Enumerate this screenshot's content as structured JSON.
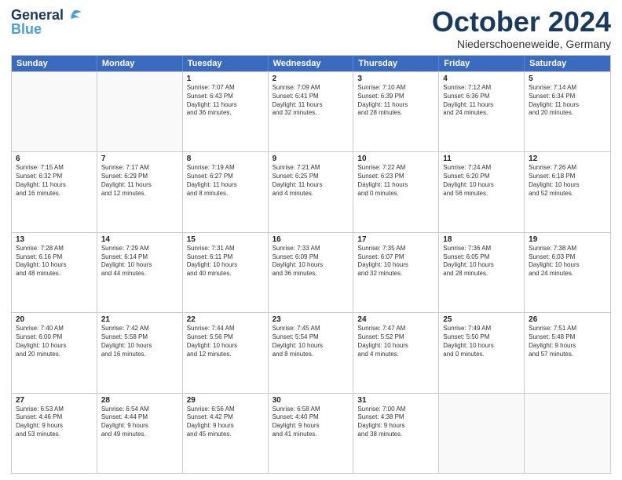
{
  "logo": {
    "line1": "General",
    "line2": "Blue"
  },
  "header": {
    "month": "October 2024",
    "location": "Niederschoeneweide, Germany"
  },
  "weekdays": [
    "Sunday",
    "Monday",
    "Tuesday",
    "Wednesday",
    "Thursday",
    "Friday",
    "Saturday"
  ],
  "weeks": [
    [
      {
        "day": "",
        "text": ""
      },
      {
        "day": "",
        "text": ""
      },
      {
        "day": "1",
        "text": "Sunrise: 7:07 AM\nSunset: 6:43 PM\nDaylight: 11 hours\nand 36 minutes."
      },
      {
        "day": "2",
        "text": "Sunrise: 7:09 AM\nSunset: 6:41 PM\nDaylight: 11 hours\nand 32 minutes."
      },
      {
        "day": "3",
        "text": "Sunrise: 7:10 AM\nSunset: 6:39 PM\nDaylight: 11 hours\nand 28 minutes."
      },
      {
        "day": "4",
        "text": "Sunrise: 7:12 AM\nSunset: 6:36 PM\nDaylight: 11 hours\nand 24 minutes."
      },
      {
        "day": "5",
        "text": "Sunrise: 7:14 AM\nSunset: 6:34 PM\nDaylight: 11 hours\nand 20 minutes."
      }
    ],
    [
      {
        "day": "6",
        "text": "Sunrise: 7:15 AM\nSunset: 6:32 PM\nDaylight: 11 hours\nand 16 minutes."
      },
      {
        "day": "7",
        "text": "Sunrise: 7:17 AM\nSunset: 6:29 PM\nDaylight: 11 hours\nand 12 minutes."
      },
      {
        "day": "8",
        "text": "Sunrise: 7:19 AM\nSunset: 6:27 PM\nDaylight: 11 hours\nand 8 minutes."
      },
      {
        "day": "9",
        "text": "Sunrise: 7:21 AM\nSunset: 6:25 PM\nDaylight: 11 hours\nand 4 minutes."
      },
      {
        "day": "10",
        "text": "Sunrise: 7:22 AM\nSunset: 6:23 PM\nDaylight: 11 hours\nand 0 minutes."
      },
      {
        "day": "11",
        "text": "Sunrise: 7:24 AM\nSunset: 6:20 PM\nDaylight: 10 hours\nand 56 minutes."
      },
      {
        "day": "12",
        "text": "Sunrise: 7:26 AM\nSunset: 6:18 PM\nDaylight: 10 hours\nand 52 minutes."
      }
    ],
    [
      {
        "day": "13",
        "text": "Sunrise: 7:28 AM\nSunset: 6:16 PM\nDaylight: 10 hours\nand 48 minutes."
      },
      {
        "day": "14",
        "text": "Sunrise: 7:29 AM\nSunset: 6:14 PM\nDaylight: 10 hours\nand 44 minutes."
      },
      {
        "day": "15",
        "text": "Sunrise: 7:31 AM\nSunset: 6:11 PM\nDaylight: 10 hours\nand 40 minutes."
      },
      {
        "day": "16",
        "text": "Sunrise: 7:33 AM\nSunset: 6:09 PM\nDaylight: 10 hours\nand 36 minutes."
      },
      {
        "day": "17",
        "text": "Sunrise: 7:35 AM\nSunset: 6:07 PM\nDaylight: 10 hours\nand 32 minutes."
      },
      {
        "day": "18",
        "text": "Sunrise: 7:36 AM\nSunset: 6:05 PM\nDaylight: 10 hours\nand 28 minutes."
      },
      {
        "day": "19",
        "text": "Sunrise: 7:38 AM\nSunset: 6:03 PM\nDaylight: 10 hours\nand 24 minutes."
      }
    ],
    [
      {
        "day": "20",
        "text": "Sunrise: 7:40 AM\nSunset: 6:00 PM\nDaylight: 10 hours\nand 20 minutes."
      },
      {
        "day": "21",
        "text": "Sunrise: 7:42 AM\nSunset: 5:58 PM\nDaylight: 10 hours\nand 16 minutes."
      },
      {
        "day": "22",
        "text": "Sunrise: 7:44 AM\nSunset: 5:56 PM\nDaylight: 10 hours\nand 12 minutes."
      },
      {
        "day": "23",
        "text": "Sunrise: 7:45 AM\nSunset: 5:54 PM\nDaylight: 10 hours\nand 8 minutes."
      },
      {
        "day": "24",
        "text": "Sunrise: 7:47 AM\nSunset: 5:52 PM\nDaylight: 10 hours\nand 4 minutes."
      },
      {
        "day": "25",
        "text": "Sunrise: 7:49 AM\nSunset: 5:50 PM\nDaylight: 10 hours\nand 0 minutes."
      },
      {
        "day": "26",
        "text": "Sunrise: 7:51 AM\nSunset: 5:48 PM\nDaylight: 9 hours\nand 57 minutes."
      }
    ],
    [
      {
        "day": "27",
        "text": "Sunrise: 6:53 AM\nSunset: 4:46 PM\nDaylight: 9 hours\nand 53 minutes."
      },
      {
        "day": "28",
        "text": "Sunrise: 6:54 AM\nSunset: 4:44 PM\nDaylight: 9 hours\nand 49 minutes."
      },
      {
        "day": "29",
        "text": "Sunrise: 6:56 AM\nSunset: 4:42 PM\nDaylight: 9 hours\nand 45 minutes."
      },
      {
        "day": "30",
        "text": "Sunrise: 6:58 AM\nSunset: 4:40 PM\nDaylight: 9 hours\nand 41 minutes."
      },
      {
        "day": "31",
        "text": "Sunrise: 7:00 AM\nSunset: 4:38 PM\nDaylight: 9 hours\nand 38 minutes."
      },
      {
        "day": "",
        "text": ""
      },
      {
        "day": "",
        "text": ""
      }
    ]
  ]
}
